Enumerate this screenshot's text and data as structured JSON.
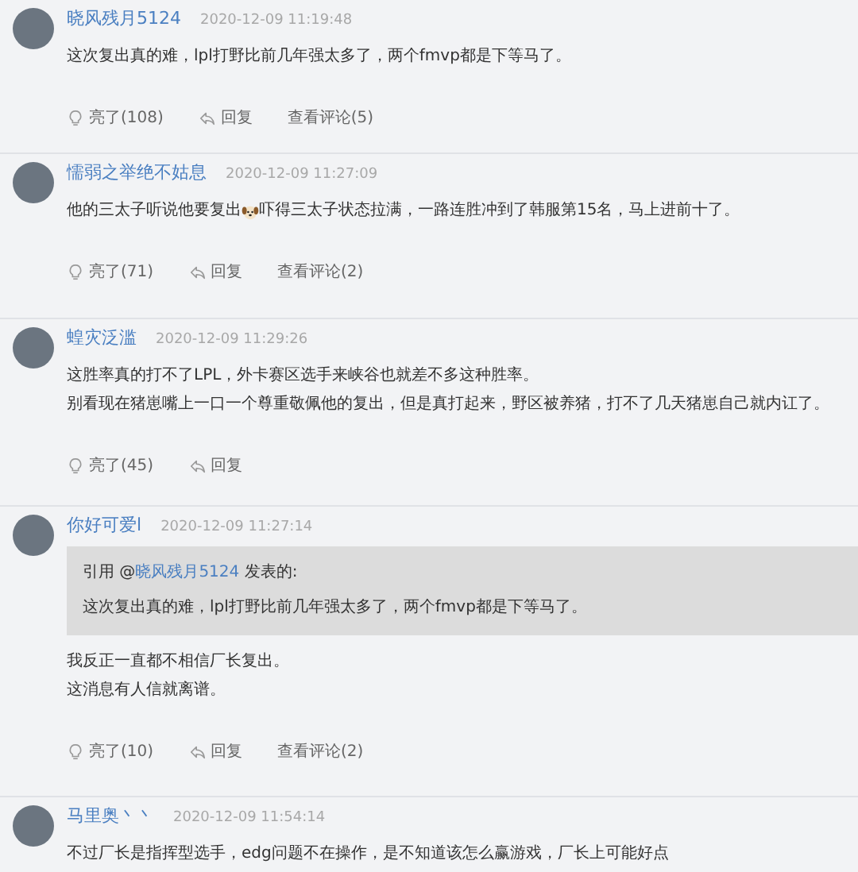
{
  "posts": [
    {
      "user": "晓风残月5124",
      "time": "2020-12-09 11:19:48",
      "body": [
        [
          {
            "kind": "text",
            "text": "这次复出真的难，lpl打野比前几年强太多了，两个fmvp都是下等马了。"
          }
        ]
      ],
      "likes": "亮了(108)",
      "reply": "回复",
      "comments": "查看评论(5)"
    },
    {
      "user": "懦弱之举绝不姑息",
      "time": "2020-12-09 11:27:09",
      "body": [
        [
          {
            "kind": "text",
            "text": "他的三太子听说他要复出"
          },
          {
            "kind": "emoji"
          },
          {
            "kind": "text",
            "text": "吓得三太子状态拉满，一路连胜冲到了韩服第15名，马上进前十了。"
          }
        ]
      ],
      "likes": "亮了(71)",
      "reply": "回复",
      "comments": "查看评论(2)"
    },
    {
      "user": "蝗灾泛滥",
      "time": "2020-12-09 11:29:26",
      "body": [
        [
          {
            "kind": "text",
            "text": "这胜率真的打不了LPL，外卡赛区选手来峡谷也就差不多这种胜率。"
          }
        ],
        [
          {
            "kind": "text",
            "text": "别看现在猪崽嘴上一口一个尊重敬佩他的复出，但是真打起来，野区被养猪，打不了几天猪崽自己就内讧了。"
          }
        ]
      ],
      "likes": "亮了(45)",
      "reply": "回复"
    },
    {
      "user": "你好可爱l",
      "time": "2020-12-09 11:27:14",
      "quote": {
        "prefix": "引用 @",
        "user": "晓风残月5124",
        "suffix": " 发表的:",
        "text": "这次复出真的难，lpl打野比前几年强太多了，两个fmvp都是下等马了。"
      },
      "body": [
        [
          {
            "kind": "text",
            "text": "我反正一直都不相信厂长复出。"
          }
        ],
        [
          {
            "kind": "text",
            "text": "这消息有人信就离谱。"
          }
        ]
      ],
      "likes": "亮了(10)",
      "reply": "回复",
      "comments": "查看评论(2)"
    },
    {
      "user": "马里奥丶丶",
      "time": "2020-12-09 11:54:14",
      "body": [
        [
          {
            "kind": "text",
            "text": "不过厂长是指挥型选手，edg问题不在操作，是不知道该怎么赢游戏，厂长上可能好点"
          }
        ]
      ]
    }
  ]
}
